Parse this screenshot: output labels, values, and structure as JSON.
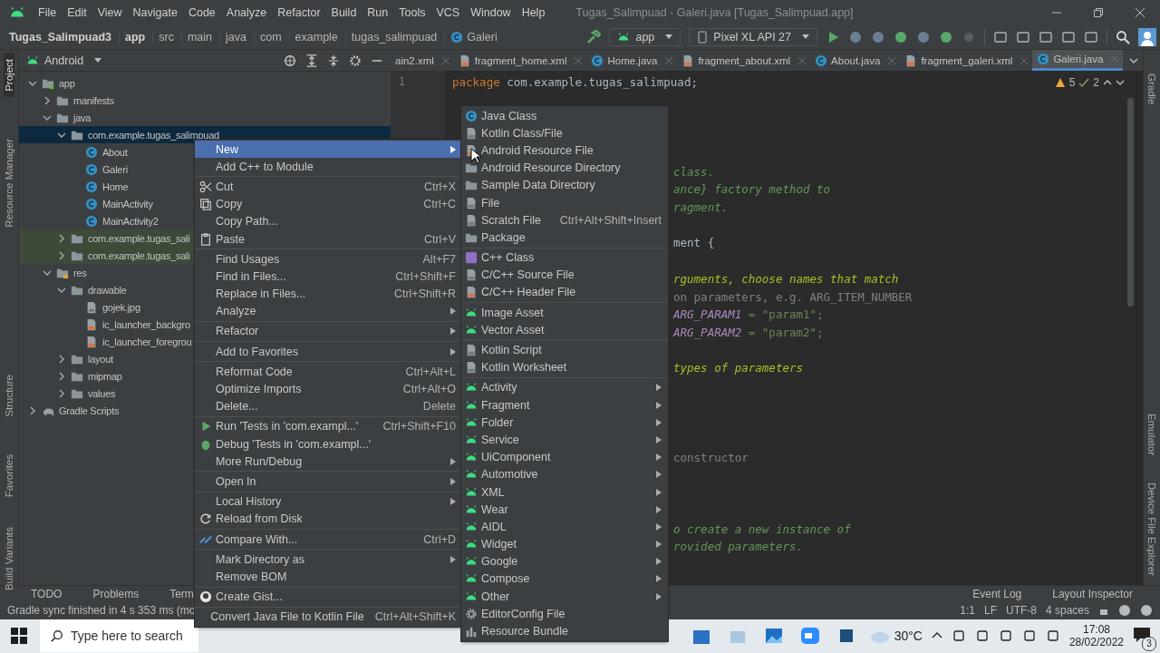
{
  "window": {
    "title": "Tugas_Salimpuad - Galeri.java [Tugas_Salimpuad.app]"
  },
  "menu_bar": [
    "File",
    "Edit",
    "View",
    "Navigate",
    "Code",
    "Analyze",
    "Refactor",
    "Build",
    "Run",
    "Tools",
    "VCS",
    "Window",
    "Help"
  ],
  "breadcrumbs": [
    {
      "label": "Tugas_Salimpuad3",
      "bold": true,
      "kind": "directory"
    },
    {
      "label": "app",
      "bold": true,
      "kind": "directory"
    },
    {
      "label": "src",
      "bold": false,
      "kind": "directory"
    },
    {
      "label": "main",
      "bold": false,
      "kind": "directory"
    },
    {
      "label": "java",
      "bold": false,
      "kind": "directory"
    },
    {
      "label": "com",
      "bold": false,
      "kind": "directory"
    },
    {
      "label": "example",
      "bold": false,
      "kind": "directory"
    },
    {
      "label": "tugas_salimpuad",
      "bold": false,
      "kind": "directory"
    },
    {
      "label": "Galeri",
      "bold": false,
      "kind": "class"
    }
  ],
  "toolbar": {
    "module": "app",
    "device": "Pixel XL API 27"
  },
  "left_strip": [
    {
      "label": "Project",
      "selected": true
    },
    {
      "label": "Resource Manager",
      "selected": false
    },
    {
      "label": "Structure",
      "selected": false
    },
    {
      "label": "Favorites",
      "selected": false
    },
    {
      "label": "Build Variants",
      "selected": false
    }
  ],
  "right_strip": [
    "Gradle",
    "Emulator",
    "Device File Explorer"
  ],
  "project_panel": {
    "view": "Android",
    "tree": [
      {
        "label": "app",
        "kind": "module",
        "expanded": true,
        "selected": false,
        "children": [
          {
            "label": "manifests",
            "kind": "folder",
            "expanded": false,
            "selected": false
          },
          {
            "label": "java",
            "kind": "folder",
            "expanded": true,
            "selected": false,
            "children": [
              {
                "label": "com.example.tugas_salimpuad",
                "kind": "package",
                "expanded": true,
                "selected": true,
                "children": [
                  {
                    "label": "About",
                    "kind": "class",
                    "selected": false
                  },
                  {
                    "label": "Galeri",
                    "kind": "class",
                    "selected": false
                  },
                  {
                    "label": "Home",
                    "kind": "class",
                    "selected": false
                  },
                  {
                    "label": "MainActivity",
                    "kind": "class",
                    "selected": false
                  },
                  {
                    "label": "MainActivity2",
                    "kind": "class",
                    "selected": false
                  }
                ]
              },
              {
                "label": "com.example.tugas_sali",
                "kind": "test-package",
                "expanded": false,
                "selected": false
              },
              {
                "label": "com.example.tugas_sali",
                "kind": "test-package",
                "expanded": false,
                "selected": false
              }
            ]
          },
          {
            "label": "res",
            "kind": "res",
            "expanded": true,
            "selected": false,
            "children": [
              {
                "label": "drawable",
                "kind": "package",
                "expanded": true,
                "selected": false,
                "children": [
                  {
                    "label": "gojek.jpg",
                    "kind": "image",
                    "selected": false
                  },
                  {
                    "label": "ic_launcher_backgro",
                    "kind": "xml",
                    "selected": false
                  },
                  {
                    "label": "ic_launcher_foregrou",
                    "kind": "xml",
                    "selected": false
                  }
                ]
              },
              {
                "label": "layout",
                "kind": "package",
                "expanded": false,
                "selected": false
              },
              {
                "label": "mipmap",
                "kind": "package",
                "expanded": false,
                "selected": false
              },
              {
                "label": "values",
                "kind": "package",
                "expanded": false,
                "selected": false
              }
            ]
          }
        ]
      },
      {
        "label": "Gradle Scripts",
        "kind": "gradle",
        "expanded": false,
        "selected": false
      }
    ]
  },
  "editor": {
    "tabs": [
      {
        "label": "ain2.xml",
        "kind": "partial",
        "selected": false
      },
      {
        "label": "fragment_home.xml",
        "kind": "xml",
        "selected": false
      },
      {
        "label": "Home.java",
        "kind": "class",
        "selected": false
      },
      {
        "label": "fragment_about.xml",
        "kind": "xml",
        "selected": false
      },
      {
        "label": "About.java",
        "kind": "class",
        "selected": false
      },
      {
        "label": "fragment_galeri.xml",
        "kind": "xml",
        "selected": false
      },
      {
        "label": "Galeri.java",
        "kind": "class",
        "selected": true
      }
    ],
    "warnings": "5",
    "weak_warnings": "2",
    "line_number": "1",
    "lines": [
      {
        "kind": "package",
        "keyword": "package",
        "text": "com.example.tugas_salimpuad;"
      },
      {
        "kind": "doc",
        "text": "class."
      },
      {
        "kind": "doc",
        "text": "ance} factory method to"
      },
      {
        "kind": "doc",
        "text": "ragment."
      },
      {
        "kind": "plain",
        "text": "ment {"
      },
      {
        "kind": "todo",
        "text": "rguments, choose names that match"
      },
      {
        "kind": "comment",
        "text": "on parameters, e.g. ARG_ITEM_NUMBER"
      },
      {
        "kind": "field",
        "name": "ARG_PARAM1",
        "text": "= \"param1\";"
      },
      {
        "kind": "field",
        "name": "ARG_PARAM2",
        "text": "= \"param2\";"
      },
      {
        "kind": "todo",
        "text": "types of parameters"
      },
      {
        "kind": "comment",
        "text": "constructor"
      },
      {
        "kind": "doc",
        "text": "o create a new instance of"
      },
      {
        "kind": "doc",
        "text": "rovided parameters."
      }
    ]
  },
  "tool_windows": [
    "TODO",
    "Problems",
    "Term"
  ],
  "tool_windows_right": [
    "Event Log",
    "Layout Inspector"
  ],
  "status_bar": {
    "message": "Gradle sync finished in 4 s 353 ms (mo",
    "position": "1:1",
    "line_separator": "LF",
    "encoding": "UTF-8",
    "indent": "4 spaces"
  },
  "context_menu": {
    "groups": [
      [
        {
          "label": "New",
          "kind": "text",
          "submenu": true,
          "selected": true
        },
        {
          "label": "Add C++ to Module",
          "kind": "text",
          "submenu": false,
          "selected": false
        }
      ],
      [
        {
          "label": "Cut",
          "shortcut": "Ctrl+X",
          "kind": "scissors",
          "submenu": false,
          "selected": false
        },
        {
          "label": "Copy",
          "shortcut": "Ctrl+C",
          "kind": "copy",
          "submenu": false,
          "selected": false
        },
        {
          "label": "Copy Path...",
          "kind": "text",
          "submenu": false,
          "selected": false
        },
        {
          "label": "Paste",
          "shortcut": "Ctrl+V",
          "kind": "paste",
          "submenu": false,
          "selected": false
        }
      ],
      [
        {
          "label": "Find Usages",
          "shortcut": "Alt+F7",
          "kind": "text",
          "submenu": false,
          "selected": false
        },
        {
          "label": "Find in Files...",
          "shortcut": "Ctrl+Shift+F",
          "kind": "text",
          "submenu": false,
          "selected": false
        },
        {
          "label": "Replace in Files...",
          "shortcut": "Ctrl+Shift+R",
          "kind": "text",
          "submenu": false,
          "selected": false
        },
        {
          "label": "Analyze",
          "kind": "text",
          "submenu": true,
          "selected": false
        }
      ],
      [
        {
          "label": "Refactor",
          "kind": "text",
          "submenu": true,
          "selected": false
        }
      ],
      [
        {
          "label": "Add to Favorites",
          "kind": "text",
          "submenu": true,
          "selected": false
        }
      ],
      [
        {
          "label": "Reformat Code",
          "shortcut": "Ctrl+Alt+L",
          "kind": "text",
          "submenu": false,
          "selected": false
        },
        {
          "label": "Optimize Imports",
          "shortcut": "Ctrl+Alt+O",
          "kind": "text",
          "submenu": false,
          "selected": false
        },
        {
          "label": "Delete...",
          "shortcut": "Delete",
          "kind": "text",
          "submenu": false,
          "selected": false
        }
      ],
      [
        {
          "label": "Run 'Tests in 'com.exampl...'",
          "shortcut": "Ctrl+Shift+F10",
          "kind": "run",
          "submenu": false,
          "selected": false
        },
        {
          "label": "Debug 'Tests in 'com.exampl...'",
          "kind": "debug",
          "submenu": false,
          "selected": false
        },
        {
          "label": "More Run/Debug",
          "kind": "text",
          "submenu": true,
          "selected": false
        }
      ],
      [
        {
          "label": "Open In",
          "kind": "text",
          "submenu": true,
          "selected": false
        }
      ],
      [
        {
          "label": "Local History",
          "kind": "text",
          "submenu": true,
          "selected": false
        },
        {
          "label": "Reload from Disk",
          "kind": "reload",
          "submenu": false,
          "selected": false
        }
      ],
      [
        {
          "label": "Compare With...",
          "shortcut": "Ctrl+D",
          "kind": "compare",
          "submenu": false,
          "selected": false
        }
      ],
      [
        {
          "label": "Mark Directory as",
          "kind": "text",
          "submenu": true,
          "selected": false
        },
        {
          "label": "Remove BOM",
          "kind": "text",
          "submenu": false,
          "selected": false
        }
      ],
      [
        {
          "label": "Create Gist...",
          "kind": "github",
          "submenu": false,
          "selected": false
        }
      ],
      [
        {
          "label": "Convert Java File to Kotlin File",
          "shortcut": "Ctrl+Alt+Shift+K",
          "kind": "text",
          "submenu": false,
          "selected": false
        }
      ]
    ]
  },
  "submenu": {
    "groups": [
      [
        {
          "label": "Java Class",
          "kind": "class",
          "submenu": false,
          "selected": false
        },
        {
          "label": "Kotlin Class/File",
          "kind": "file",
          "submenu": false,
          "selected": false
        },
        {
          "label": "Android Resource File",
          "kind": "xml",
          "submenu": false,
          "selected": false
        },
        {
          "label": "Android Resource Directory",
          "kind": "folder",
          "submenu": false,
          "selected": false
        },
        {
          "label": "Sample Data Directory",
          "kind": "folder",
          "submenu": false,
          "selected": false
        },
        {
          "label": "File",
          "kind": "file",
          "submenu": false,
          "selected": false
        },
        {
          "label": "Scratch File",
          "shortcut": "Ctrl+Alt+Shift+Insert",
          "kind": "file",
          "submenu": false,
          "selected": false
        },
        {
          "label": "Package",
          "kind": "package",
          "submenu": false,
          "selected": false
        }
      ],
      [
        {
          "label": "C++ Class",
          "kind": "cpp",
          "submenu": false,
          "selected": false
        },
        {
          "label": "C/C++ Source File",
          "kind": "file",
          "submenu": false,
          "selected": false
        },
        {
          "label": "C/C++ Header File",
          "kind": "xml",
          "submenu": false,
          "selected": false
        }
      ],
      [
        {
          "label": "Image Asset",
          "kind": "android",
          "submenu": false,
          "selected": false
        },
        {
          "label": "Vector Asset",
          "kind": "android",
          "submenu": false,
          "selected": false
        }
      ],
      [
        {
          "label": "Kotlin Script",
          "kind": "file",
          "submenu": false,
          "selected": false
        },
        {
          "label": "Kotlin Worksheet",
          "kind": "file",
          "submenu": false,
          "selected": false
        }
      ],
      [
        {
          "label": "Activity",
          "kind": "android",
          "submenu": true,
          "selected": false
        },
        {
          "label": "Fragment",
          "kind": "android",
          "submenu": true,
          "selected": false
        },
        {
          "label": "Folder",
          "kind": "android",
          "submenu": true,
          "selected": false
        },
        {
          "label": "Service",
          "kind": "android",
          "submenu": true,
          "selected": false
        },
        {
          "label": "UiComponent",
          "kind": "android",
          "submenu": true,
          "selected": false
        },
        {
          "label": "Automotive",
          "kind": "android",
          "submenu": true,
          "selected": false
        },
        {
          "label": "XML",
          "kind": "android",
          "submenu": true,
          "selected": false
        },
        {
          "label": "Wear",
          "kind": "android",
          "submenu": true,
          "selected": false
        },
        {
          "label": "AIDL",
          "kind": "android",
          "submenu": true,
          "selected": false
        },
        {
          "label": "Widget",
          "kind": "android",
          "submenu": true,
          "selected": false
        },
        {
          "label": "Google",
          "kind": "android",
          "submenu": true,
          "selected": false
        },
        {
          "label": "Compose",
          "kind": "android",
          "submenu": true,
          "selected": false
        },
        {
          "label": "Other",
          "kind": "android",
          "submenu": true,
          "selected": false
        },
        {
          "label": "EditorConfig File",
          "kind": "gear",
          "submenu": false,
          "selected": false
        },
        {
          "label": "Resource Bundle",
          "kind": "bundle",
          "submenu": false,
          "selected": false
        }
      ]
    ]
  },
  "taskbar": {
    "search_placeholder": "Type here to search",
    "weather": "30°C",
    "time": "17:08",
    "date": "28/02/2022",
    "notifications": "3"
  }
}
